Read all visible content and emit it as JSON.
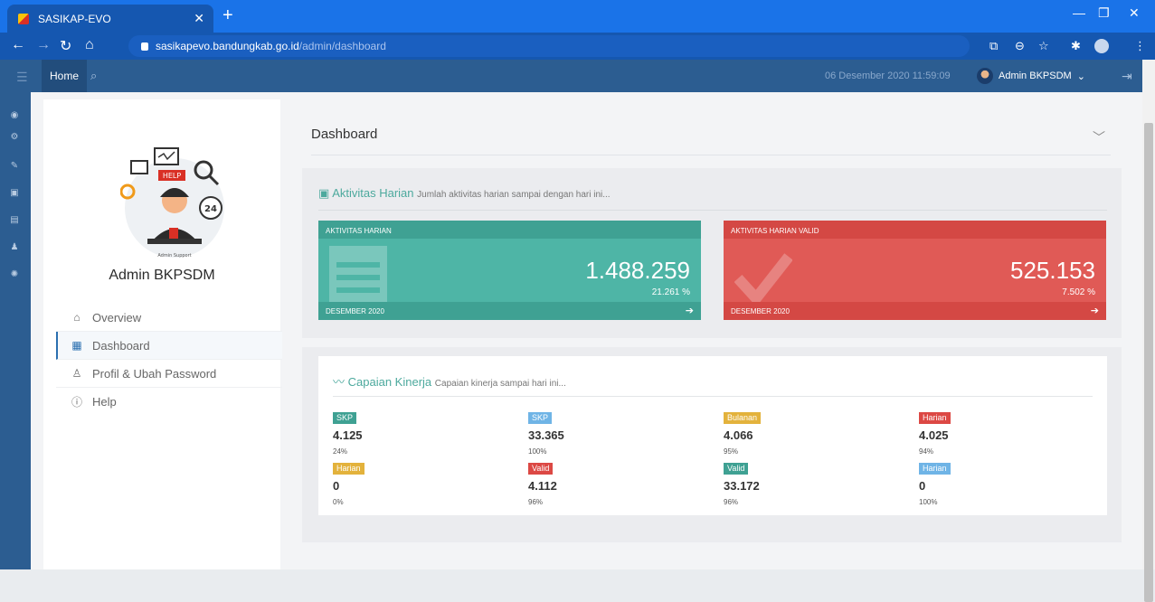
{
  "browser": {
    "tab_title": "SASIKAP-EVO",
    "tab_close": "✕",
    "new_tab": "+",
    "url_host": "sasikapevo.bandungkab.go.id",
    "url_path": "/admin/dashboard",
    "window_controls": [
      "—",
      "❐",
      "✕"
    ],
    "nav_icons": [
      "back-arrow-icon",
      "forward-arrow-icon",
      "reload-icon",
      "home-icon"
    ]
  },
  "topbar": {
    "home_label": "Home",
    "datetime": "06 Desember 2020 11:59:09",
    "user_name": "Admin BKPSDM",
    "user_caret": "⌄"
  },
  "profile": {
    "name": "Admin BKPSDM",
    "illustration_text": "HELP",
    "illustration_badge": "24",
    "illustration_caption": "Admin Support"
  },
  "menu": {
    "items": [
      {
        "label": "Overview",
        "icon": "home-icon"
      },
      {
        "label": "Dashboard",
        "icon": "dashboard-icon"
      },
      {
        "label": "Profil & Ubah Password",
        "icon": "user-icon"
      },
      {
        "label": "Help",
        "icon": "info-icon"
      }
    ]
  },
  "dashboard": {
    "title": "Dashboard",
    "aktivitas_title": "Aktivitas Harian",
    "aktivitas_sub": "Jumlah aktivitas harian sampai dengan hari ini...",
    "card_green": {
      "head": "AKTIVITAS HARIAN",
      "value": "1.488.259",
      "pct": "21.261 %",
      "foot": "DESEMBER 2020"
    },
    "card_red": {
      "head": "AKTIVITAS HARIAN VALID",
      "value": "525.153",
      "pct": "7.502 %",
      "foot": "DESEMBER 2020"
    },
    "capaian_title": "Capaian Kinerja",
    "capaian_sub": "Capaian kinerja sampai hari ini...",
    "stats": [
      {
        "badge": "SKP",
        "value": "4.125",
        "pct": "24%",
        "color": "#3fa193"
      },
      {
        "badge": "SKP",
        "value": "33.365",
        "pct": "100%",
        "color": "#6fb4e6"
      },
      {
        "badge": "Bulanan",
        "value": "4.066",
        "pct": "95%",
        "color": "#e3b23c"
      },
      {
        "badge": "Harian",
        "value": "4.025",
        "pct": "94%",
        "color": "#dc4844"
      },
      {
        "badge": "Harian",
        "value": "0",
        "pct": "0%",
        "color": "#e3b23c"
      },
      {
        "badge": "Valid",
        "value": "4.112",
        "pct": "96%",
        "color": "#dc4844"
      },
      {
        "badge": "Valid",
        "value": "33.172",
        "pct": "96%",
        "color": "#3fa193"
      },
      {
        "badge": "Harian",
        "value": "0",
        "pct": "100%",
        "color": "#6fb4e6"
      }
    ]
  }
}
